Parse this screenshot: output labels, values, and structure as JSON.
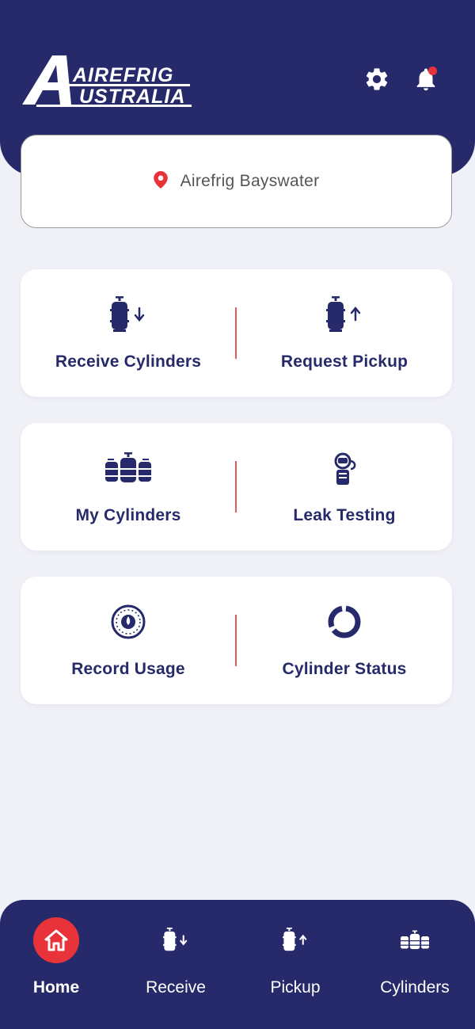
{
  "brand": {
    "line1": "AIREFRIG",
    "line2": "USTRALIA",
    "logo_letter": "A"
  },
  "header": {
    "settings_icon": "gear-icon",
    "notifications_icon": "bell-icon",
    "has_notification": true
  },
  "location": {
    "icon": "map-pin-icon",
    "name": "Airefrig Bayswater"
  },
  "actions": [
    {
      "label": "Receive Cylinders",
      "icon": "cylinder-down-icon"
    },
    {
      "label": "Request Pickup",
      "icon": "cylinder-up-icon"
    },
    {
      "label": "My Cylinders",
      "icon": "cylinders-group-icon"
    },
    {
      "label": "Leak Testing",
      "icon": "leak-detector-icon"
    },
    {
      "label": "Record Usage",
      "icon": "gauge-icon"
    },
    {
      "label": "Cylinder Status",
      "icon": "status-ring-icon"
    }
  ],
  "bottom_nav": [
    {
      "label": "Home",
      "icon": "home-icon",
      "active": true
    },
    {
      "label": "Receive",
      "icon": "cylinder-down-icon",
      "active": false
    },
    {
      "label": "Pickup",
      "icon": "cylinder-up-icon",
      "active": false
    },
    {
      "label": "Cylinders",
      "icon": "cylinders-group-icon",
      "active": false
    }
  ],
  "colors": {
    "primary": "#262a6a",
    "accent": "#e8333b",
    "background": "#f0f0f7",
    "card": "#ffffff"
  }
}
